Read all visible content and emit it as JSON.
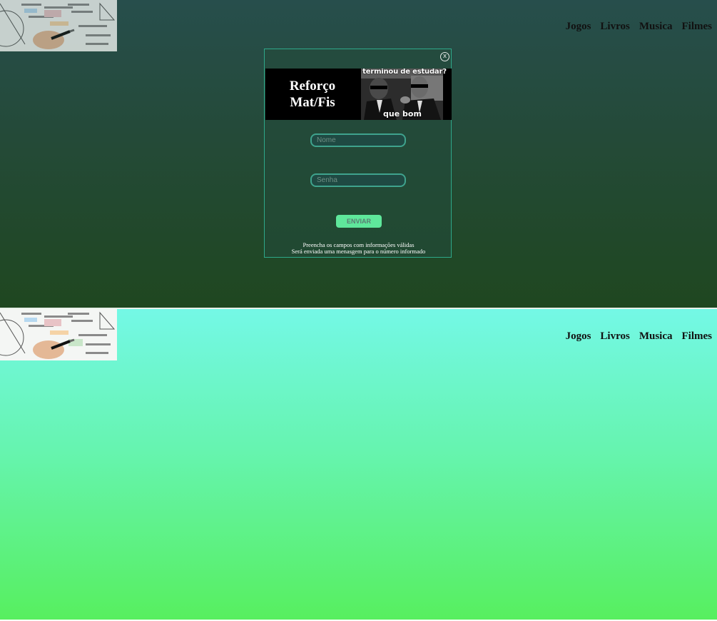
{
  "nav": [
    "Jogos",
    "Livros",
    "Musica",
    "Filmes"
  ],
  "modal": {
    "close_label": "x",
    "banner_title": "Reforço Mat/Fis",
    "meme_top": "terminou de estudar?",
    "meme_bottom": "que bom",
    "name_placeholder": "Nome",
    "password_placeholder": "Senha",
    "submit_label": "ENVIAR",
    "help_line1": "Preencha os campos com informações válidas",
    "help_line2": "Será enviada uma menasgem para o número informado"
  },
  "colors": {
    "top_gradient": [
      "#274e4c",
      "#1f4720"
    ],
    "bottom_gradient": [
      "#74f8e6",
      "#57ef5f"
    ],
    "modal_border": "#2ea88a",
    "button": "#5fe79b"
  },
  "icons": [
    "close-icon",
    "math-notes-logo",
    "meme-image"
  ]
}
